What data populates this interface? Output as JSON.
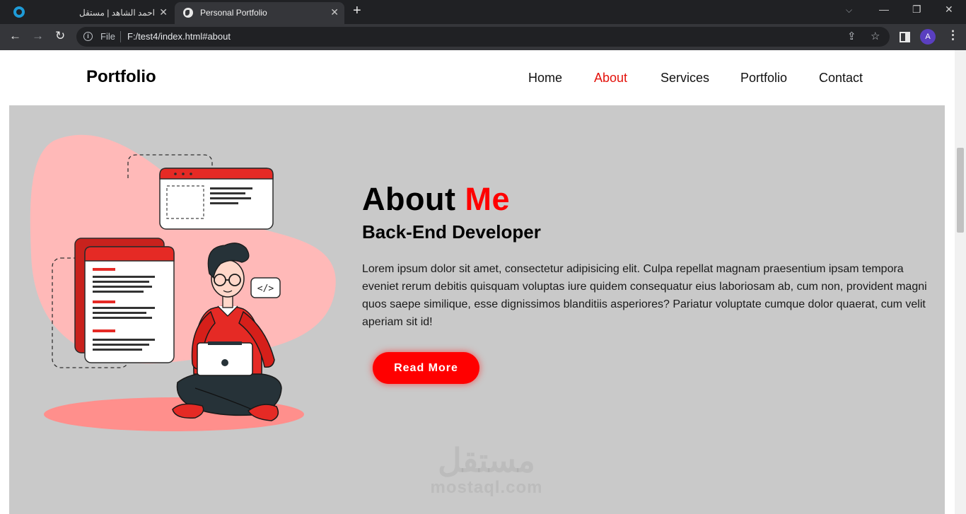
{
  "browser": {
    "tabs": [
      {
        "title": "احمد الشاهد | مستقل",
        "close": "✕"
      },
      {
        "title": "Personal Portfolio",
        "close": "✕"
      }
    ],
    "new_tab": "+",
    "window_controls": {
      "tab_search": "⌵",
      "minimize": "—",
      "restore": "❐",
      "close": "✕"
    },
    "nav": {
      "back": "←",
      "forward": "→",
      "reload": "↻"
    },
    "address": {
      "scheme_label": "File",
      "url": "F:/test4/index.html#about"
    },
    "omni_icons": {
      "share": "⇪",
      "bookmark": "☆"
    },
    "profile_initial": "A",
    "menu": "⋮"
  },
  "site": {
    "logo": "Portfolio",
    "nav": [
      "Home",
      "About",
      "Services",
      "Portfolio",
      "Contact"
    ],
    "active_nav": "About"
  },
  "about": {
    "title_main": "About",
    "title_accent": "Me",
    "subtitle": "Back-End Developer",
    "text": "Lorem ipsum dolor sit amet, consectetur adipisicing elit. Culpa repellat magnam praesentium ipsam tempora eveniet rerum debitis quisquam voluptas iure quidem consequatur eius laboriosam ab, cum non, provident magni quos saepe similique, esse dignissimos blanditiis asperiores? Pariatur voluptate cumque dolor quaerat, cum velit aperiam sit id!",
    "button": "Read More",
    "illustration_code_tag": "</>"
  },
  "watermark": {
    "arabic": "مستقل",
    "latin": "mostaql.com"
  },
  "colors": {
    "accent": "#ff0000",
    "section_bg": "#c9c9c9",
    "illustration_red": "#e52a25",
    "blob": "#ffb9b8"
  }
}
